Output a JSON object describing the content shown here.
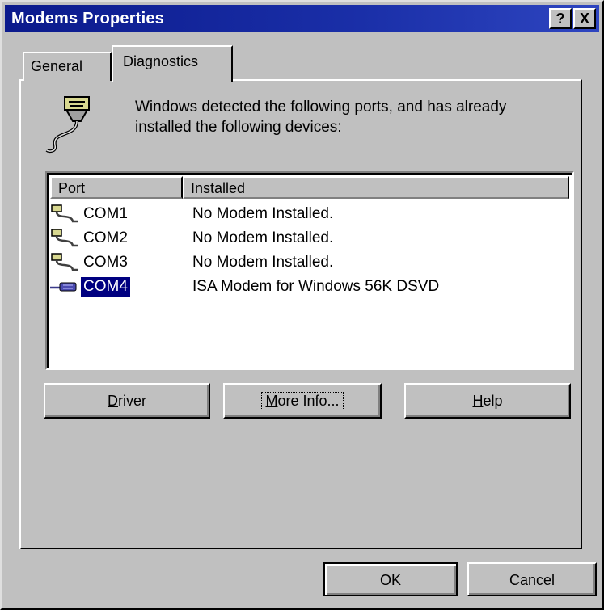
{
  "window": {
    "title": "Modems Properties"
  },
  "titlebar_buttons": {
    "help": "?",
    "close": "X"
  },
  "tabs": [
    {
      "label": "General",
      "selected": false
    },
    {
      "label": "Diagnostics",
      "selected": true
    }
  ],
  "info_text": "Windows detected the following ports, and has already installed the following devices:",
  "list": {
    "columns": [
      "Port",
      "Installed"
    ],
    "rows": [
      {
        "port": "COM1",
        "installed": "No Modem Installed.",
        "icon": "serial-port-icon",
        "selected": false
      },
      {
        "port": "COM2",
        "installed": "No Modem Installed.",
        "icon": "serial-port-icon",
        "selected": false
      },
      {
        "port": "COM3",
        "installed": "No Modem Installed.",
        "icon": "serial-port-icon",
        "selected": false
      },
      {
        "port": "COM4",
        "installed": "ISA Modem for Windows 56K DSVD",
        "icon": "modem-icon",
        "selected": true
      }
    ]
  },
  "buttons": {
    "driver": {
      "mnemonic": "D",
      "rest": "river"
    },
    "more_info": {
      "prefix": "",
      "mnemonic": "M",
      "rest": "ore Info..."
    },
    "help": {
      "mnemonic": "H",
      "rest": "elp"
    },
    "ok": "OK",
    "cancel": "Cancel"
  },
  "colors": {
    "title_bar": "#0b1a8c",
    "selection": "#000080",
    "face": "#c0c0c0"
  }
}
